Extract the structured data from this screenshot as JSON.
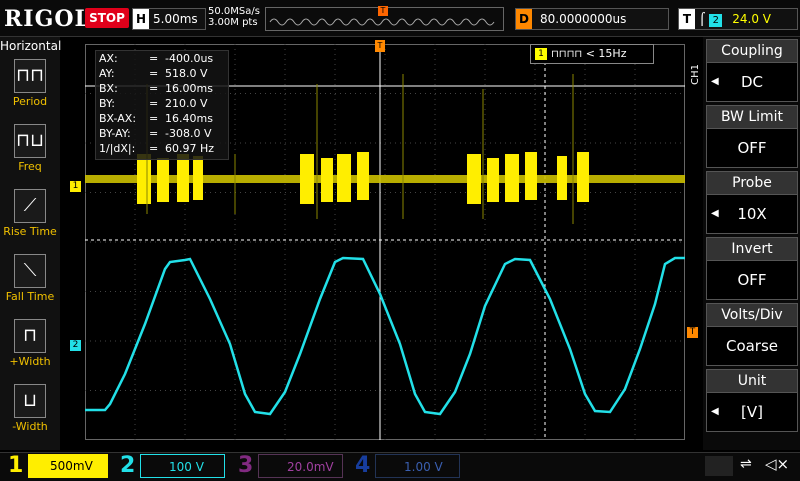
{
  "top": {
    "logo": "RIGOL",
    "state": "STOP",
    "h_label": "H",
    "timebase": "5.00ms",
    "sample_rate": "50.0MSa/s",
    "mem_depth": "3.00M pts",
    "d_label": "D",
    "delay": "80.0000000us",
    "t_label": "T",
    "trigger_channel": "2",
    "trigger_level": "24.0 V"
  },
  "left_panel": {
    "title": "Horizontal",
    "items": [
      {
        "label": "Period",
        "icon": "period-icon"
      },
      {
        "label": "Freq",
        "icon": "freq-icon"
      },
      {
        "label": "Rise Time",
        "icon": "rise-time-icon"
      },
      {
        "label": "Fall Time",
        "icon": "fall-time-icon"
      },
      {
        "label": "+Width",
        "icon": "pos-width-icon"
      },
      {
        "label": "-Width",
        "icon": "neg-width-icon"
      }
    ]
  },
  "cursors": [
    {
      "key": "AX:",
      "value": "-400.0us"
    },
    {
      "key": "AY:",
      "value": "518.0 V"
    },
    {
      "key": "BX:",
      "value": "16.00ms"
    },
    {
      "key": "BY:",
      "value": "210.0 V"
    },
    {
      "key": "BX-AX:",
      "value": "16.40ms"
    },
    {
      "key": "BY-AY:",
      "value": "-308.0 V"
    },
    {
      "key": "1/|dX|:",
      "value": "60.97 Hz"
    }
  ],
  "freq_box": {
    "channel": "1",
    "text": "< 15Hz"
  },
  "channel_markers": {
    "ch1": "1",
    "ch2": "2",
    "trig": "T"
  },
  "right_panel": {
    "ch_tag": "CH1",
    "items": [
      {
        "title": "Coupling",
        "value": "DC"
      },
      {
        "title": "BW Limit",
        "value": "OFF"
      },
      {
        "title": "Probe",
        "value": "10X"
      },
      {
        "title": "Invert",
        "value": "OFF"
      },
      {
        "title": "Volts/Div",
        "value": "Coarse"
      },
      {
        "title": "Unit",
        "value": "[V]"
      }
    ]
  },
  "bottom": {
    "channels": [
      {
        "num": "1",
        "scale": "500mV",
        "color": "#ffee00"
      },
      {
        "num": "2",
        "scale": "100 V",
        "color": "#22e0e8"
      },
      {
        "num": "3",
        "scale": "20.0mV",
        "color": "#d040d0"
      },
      {
        "num": "4",
        "scale": "1.00 V",
        "color": "#2060ff"
      }
    ]
  },
  "colors": {
    "ch1": "#ffee00",
    "ch2": "#22e0e8",
    "accent": "#ff8800",
    "stop": "#e0001a"
  }
}
